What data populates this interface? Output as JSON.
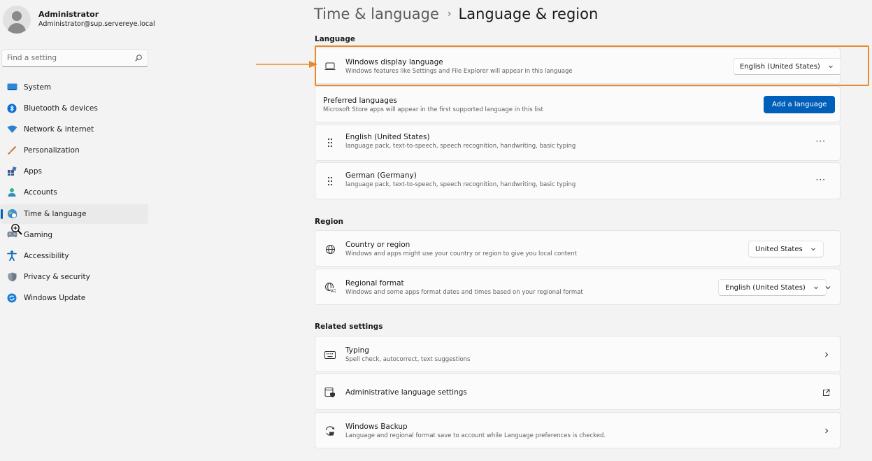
{
  "profile": {
    "name": "Administrator",
    "email": "Administrator@sup.servereye.local"
  },
  "search": {
    "placeholder": "Find a setting"
  },
  "sidebar": {
    "items": [
      {
        "label": "System",
        "icon": "system-icon"
      },
      {
        "label": "Bluetooth & devices",
        "icon": "bluetooth-icon"
      },
      {
        "label": "Network & internet",
        "icon": "wifi-icon"
      },
      {
        "label": "Personalization",
        "icon": "brush-icon"
      },
      {
        "label": "Apps",
        "icon": "apps-icon"
      },
      {
        "label": "Accounts",
        "icon": "person-icon"
      },
      {
        "label": "Time & language",
        "icon": "globe-clock-icon",
        "active": true
      },
      {
        "label": "Gaming",
        "icon": "gamepad-icon"
      },
      {
        "label": "Accessibility",
        "icon": "accessibility-icon"
      },
      {
        "label": "Privacy & security",
        "icon": "shield-icon"
      },
      {
        "label": "Windows Update",
        "icon": "update-icon"
      }
    ]
  },
  "breadcrumb": {
    "parent": "Time & language",
    "separator": "›",
    "current": "Language & region"
  },
  "language": {
    "section_title": "Language",
    "display_language": {
      "title": "Windows display language",
      "subtitle": "Windows features like Settings and File Explorer will appear in this language",
      "value": "English (United States)"
    },
    "preferred": {
      "title": "Preferred languages",
      "subtitle": "Microsoft Store apps will appear in the first supported language in this list",
      "button": "Add a language"
    },
    "languages": [
      {
        "name": "English (United States)",
        "features": "language pack, text-to-speech, speech recognition, handwriting, basic typing"
      },
      {
        "name": "German (Germany)",
        "features": "language pack, text-to-speech, speech recognition, handwriting, basic typing"
      }
    ],
    "more_label": "···"
  },
  "region": {
    "section_title": "Region",
    "country": {
      "title": "Country or region",
      "subtitle": "Windows and apps might use your country or region to give you local content",
      "value": "United States"
    },
    "format": {
      "title": "Regional format",
      "subtitle": "Windows and some apps format dates and times based on your regional format",
      "value": "English (United States)"
    }
  },
  "related": {
    "section_title": "Related settings",
    "typing": {
      "title": "Typing",
      "subtitle": "Spell check, autocorrect, text suggestions"
    },
    "admin": {
      "title": "Administrative language settings"
    },
    "backup": {
      "title": "Windows Backup",
      "subtitle": "Language and regional format save to account while Language preferences is checked."
    }
  },
  "colors": {
    "accent": "#005fb8",
    "highlight": "#e8892e",
    "background": "#f3f3f3",
    "card": "#fbfbfb"
  }
}
